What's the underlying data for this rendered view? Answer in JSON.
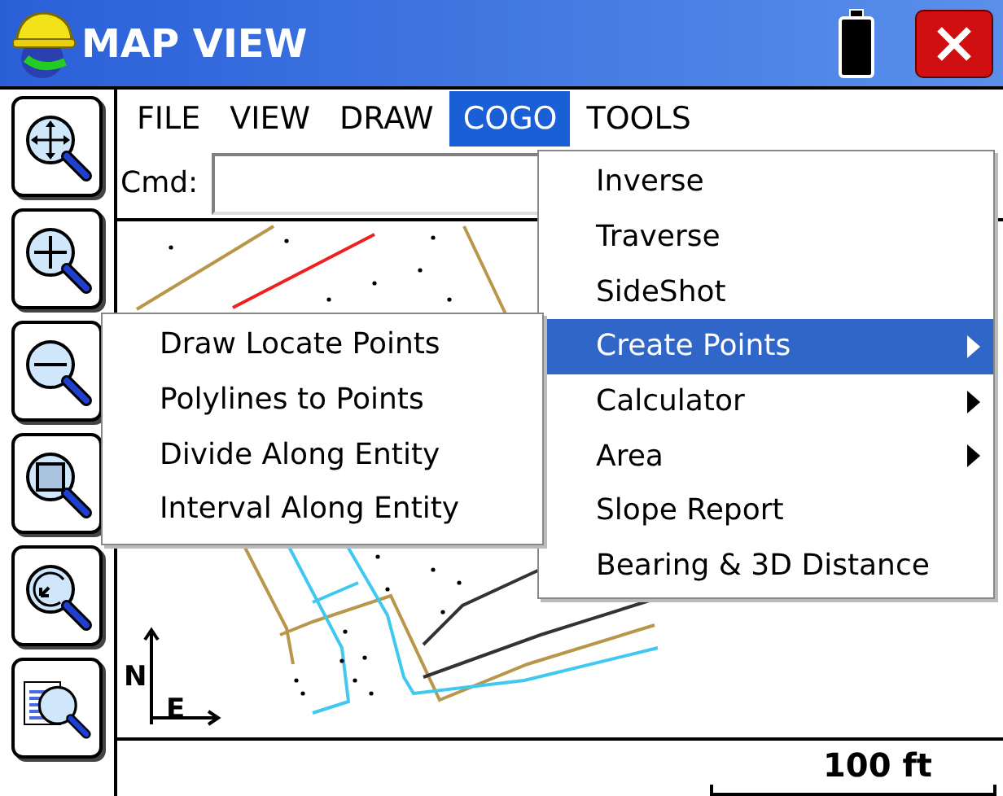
{
  "window": {
    "title": "MAP VIEW"
  },
  "menu_bar": [
    {
      "label": "FILE",
      "selected": false
    },
    {
      "label": "VIEW",
      "selected": false
    },
    {
      "label": "DRAW",
      "selected": false
    },
    {
      "label": "COGO",
      "selected": true
    },
    {
      "label": "TOOLS",
      "selected": false
    }
  ],
  "command": {
    "label": "Cmd:"
  },
  "cogo_menu": [
    {
      "label": "Inverse",
      "selected": false,
      "submenu": false
    },
    {
      "label": "Traverse",
      "selected": false,
      "submenu": false
    },
    {
      "label": "SideShot",
      "selected": false,
      "submenu": false
    },
    {
      "label": "Create Points",
      "selected": true,
      "submenu": true
    },
    {
      "label": "Calculator",
      "selected": false,
      "submenu": true
    },
    {
      "label": "Area",
      "selected": false,
      "submenu": true
    },
    {
      "label": "Slope Report",
      "selected": false,
      "submenu": false
    },
    {
      "label": "Bearing & 3D Distance",
      "selected": false,
      "submenu": false
    }
  ],
  "create_points_menu": [
    {
      "label": "Draw Locate Points"
    },
    {
      "label": "Polylines to Points"
    },
    {
      "label": "Divide Along Entity"
    },
    {
      "label": "Interval Along Entity"
    }
  ],
  "compass": {
    "north": "N",
    "east": "E"
  },
  "scale": {
    "label": "100 ft"
  }
}
